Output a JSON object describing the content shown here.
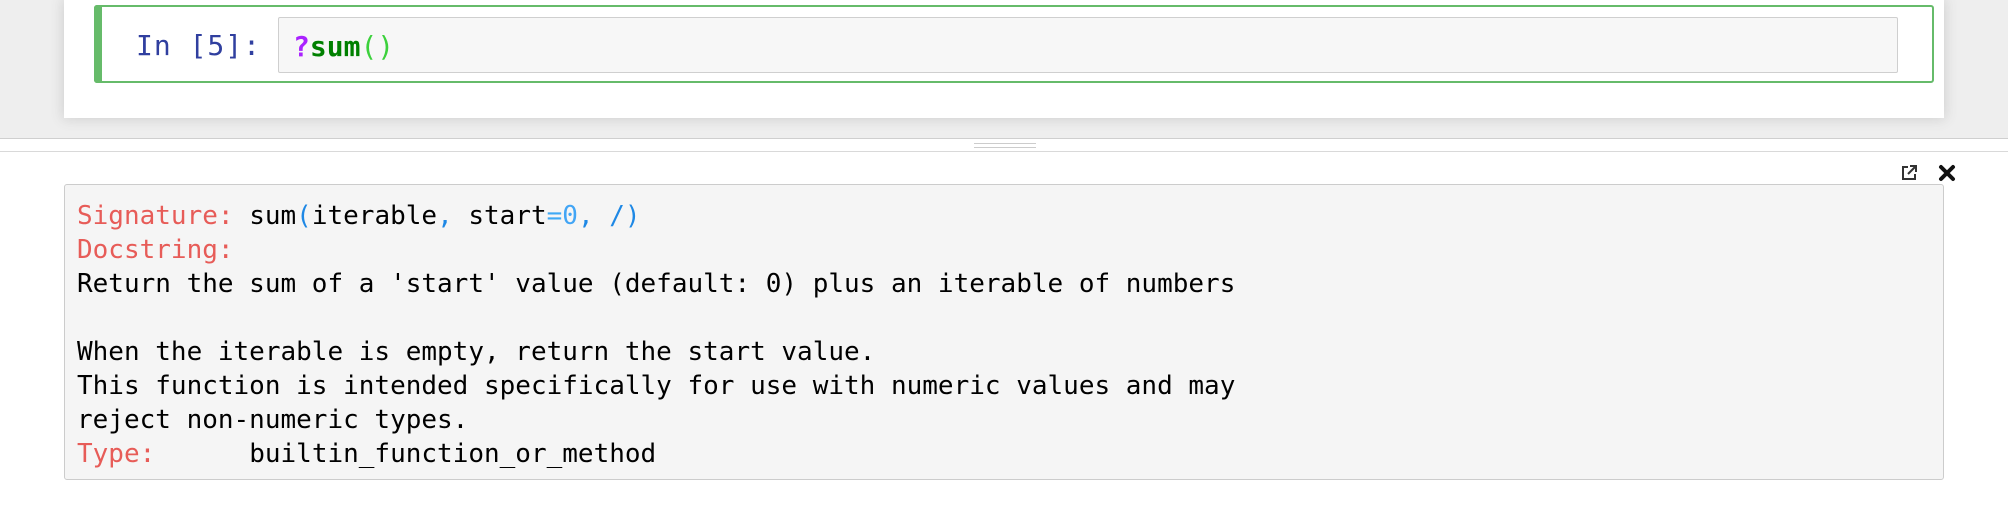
{
  "cell": {
    "prompt": "In [5]:",
    "code_op": "?",
    "code_name": "sum",
    "code_parens": "()"
  },
  "pager": {
    "controls": {
      "popout_icon": "external-link-icon",
      "close_icon": "close-icon"
    },
    "signature": {
      "label": "Signature:",
      "func": "sum",
      "open_paren": "(",
      "arg1": "iterable",
      "comma1": ",",
      "arg2": " start",
      "equals": "=",
      "default": "0",
      "comma2": ",",
      "slash": " /",
      "close_paren": ")"
    },
    "docstring_label": "Docstring:",
    "docstring_lines": [
      "Return the sum of a 'start' value (default: 0) plus an iterable of numbers",
      "",
      "When the iterable is empty, return the start value.",
      "This function is intended specifically for use with numeric values and may",
      "reject non-numeric types."
    ],
    "type_label": "Type:",
    "type_value": "builtin_function_or_method"
  },
  "colors": {
    "label": "#e75c58",
    "cell_border": "#66bb6a",
    "prompt": "#303f9f"
  }
}
